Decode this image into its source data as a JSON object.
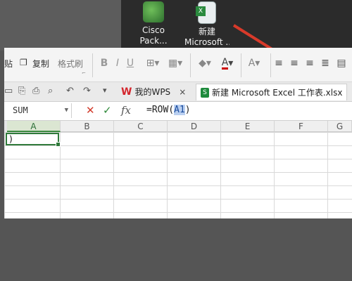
{
  "desktop": {
    "icons": [
      {
        "label_line1": "Cisco",
        "label_line2": "Pack..."
      },
      {
        "label_line1": "新建",
        "label_line2": "Microsoft ..."
      }
    ]
  },
  "ribbon": {
    "paste_label": "贴",
    "copy_label": "复制",
    "format_painter_label": "格式刷",
    "bold": "B",
    "italic": "I",
    "underline": "U"
  },
  "tabbar": {
    "wps_tab": "我的WPS",
    "close_glyph": "×",
    "doc_tab": "新建 Microsoft Excel 工作表.xlsx"
  },
  "formula_bar": {
    "name_box": "SUM",
    "cancel": "✕",
    "confirm": "✓",
    "fx": "fx",
    "formula_prefix": "=ROW(",
    "formula_ref": "A1",
    "formula_suffix": ")"
  },
  "sheet": {
    "columns": [
      "A",
      "B",
      "C",
      "D",
      "E",
      "F",
      "G"
    ],
    "active_cell_text": ")"
  }
}
